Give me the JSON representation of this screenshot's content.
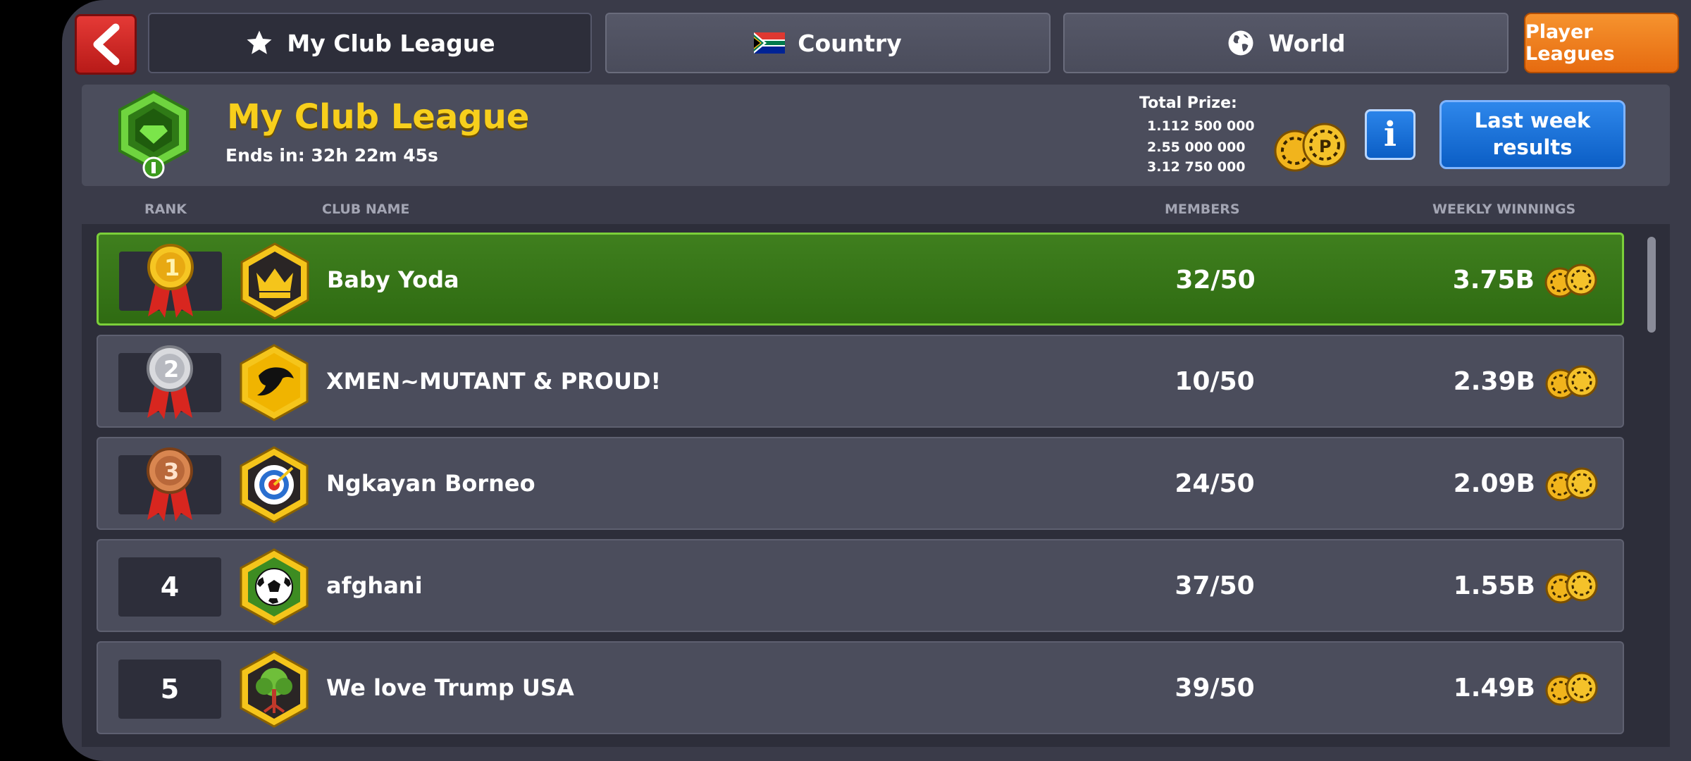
{
  "tabs": [
    {
      "label": "My Club League",
      "icon": "star-icon",
      "active": true
    },
    {
      "label": "Country",
      "icon": "south-africa-flag-icon",
      "active": false
    },
    {
      "label": "World",
      "icon": "globe-icon",
      "active": false
    }
  ],
  "player_leagues_label": "Player Leagues",
  "header": {
    "title": "My Club League",
    "ends_in": "Ends in: 32h 22m 45s",
    "total_prize_label": "Total Prize:",
    "prizes": [
      "1.112 500 000",
      "2.55 000 000",
      "3.12 750 000"
    ],
    "info_label": "i",
    "last_week_button": "Last week\nresults"
  },
  "columns": {
    "rank": "RANK",
    "club_name": "CLUB NAME",
    "members": "MEMBERS",
    "weekly_winnings": "WEEKLY WINNINGS"
  },
  "rows": [
    {
      "rank": "1",
      "name": "Baby Yoda",
      "members": "32/50",
      "winnings": "3.75B",
      "badge": "crown-icon",
      "medal": "gold"
    },
    {
      "rank": "2",
      "name": "XMEN~MUTANT & PROUD!",
      "members": "10/50",
      "winnings": "2.39B",
      "badge": "eagle-icon",
      "medal": "silver"
    },
    {
      "rank": "3",
      "name": "Ngkayan Borneo",
      "members": "24/50",
      "winnings": "2.09B",
      "badge": "target-icon",
      "medal": "bronze"
    },
    {
      "rank": "4",
      "name": "afghani",
      "members": "37/50",
      "winnings": "1.55B",
      "badge": "soccer-ball-icon",
      "medal": ""
    },
    {
      "rank": "5",
      "name": "We love Trump USA",
      "members": "39/50",
      "winnings": "1.49B",
      "badge": "tree-icon",
      "medal": ""
    }
  ],
  "colors": {
    "accent_gold": "#f7cf1c",
    "highlight_green": "#3f7f1e",
    "button_blue": "#0b5ec5",
    "button_orange": "#e66b10"
  }
}
